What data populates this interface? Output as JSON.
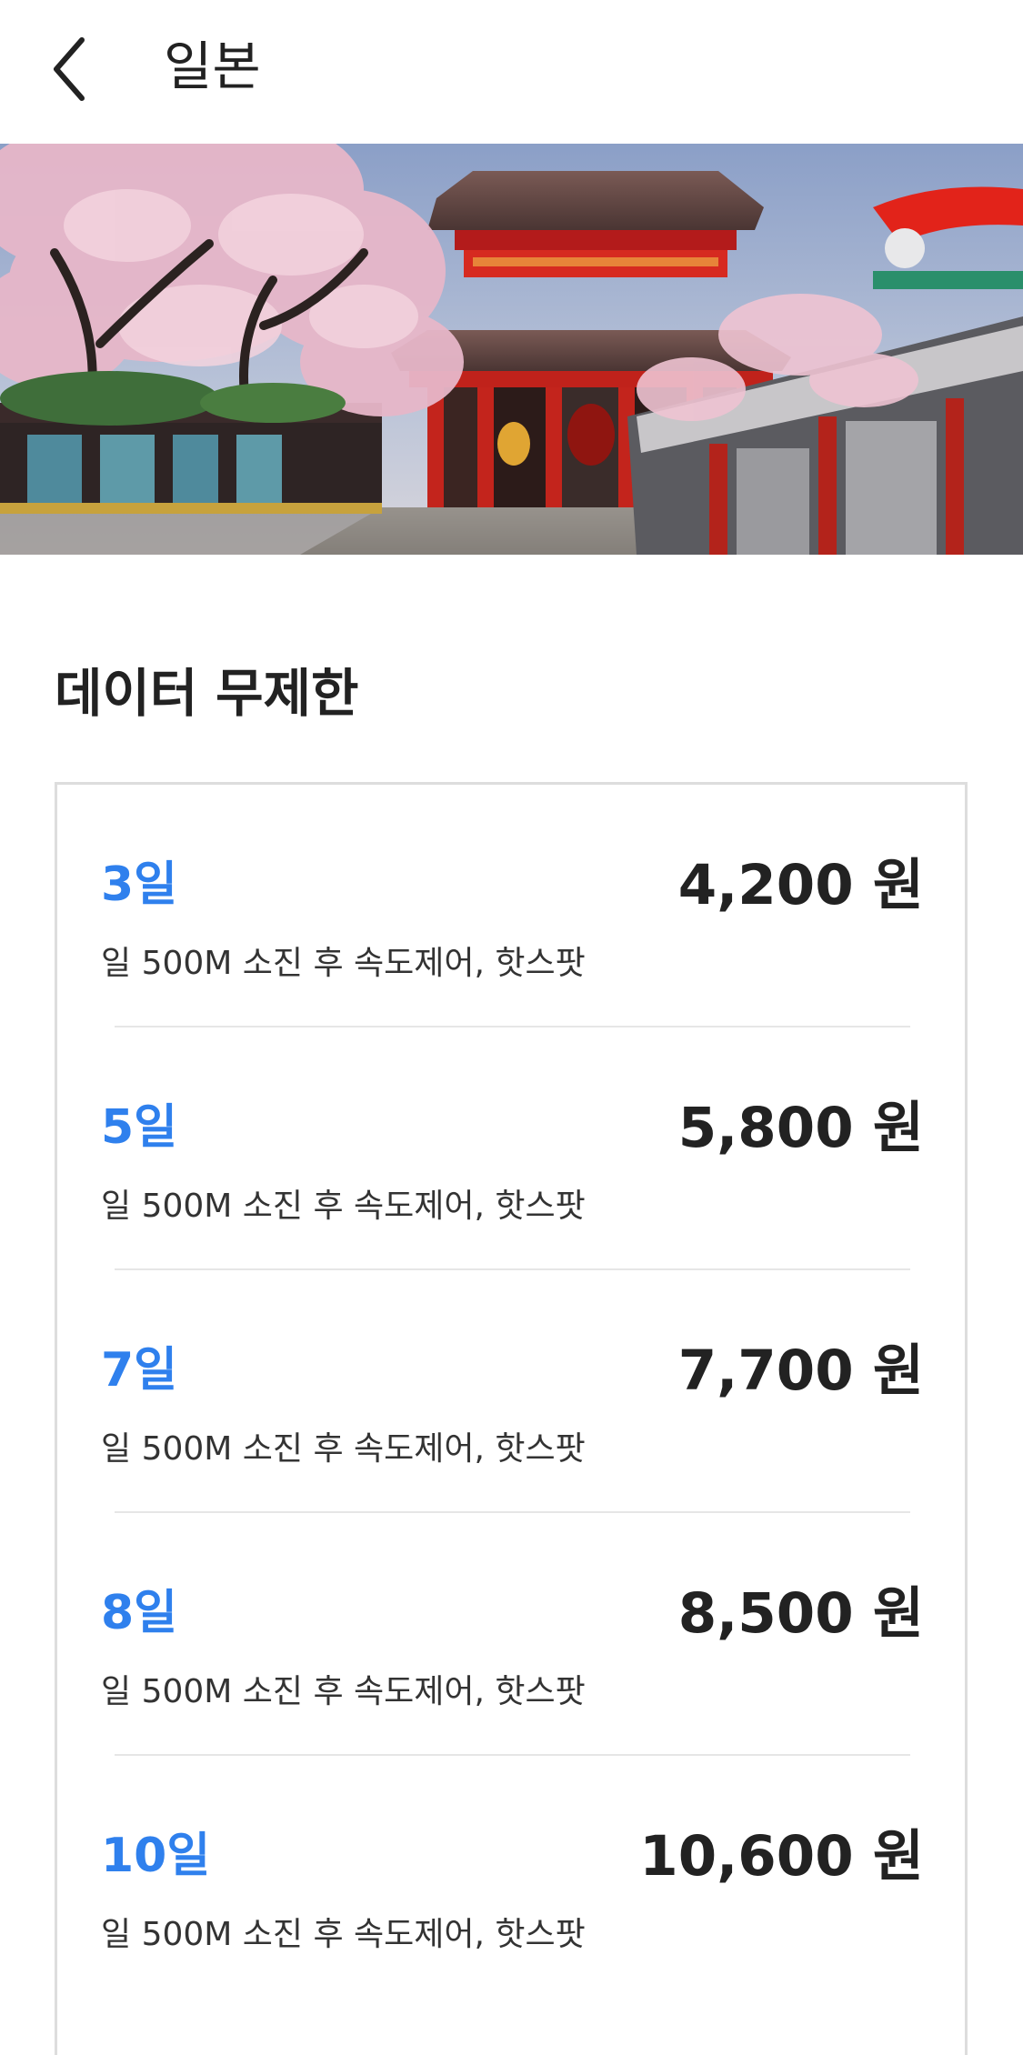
{
  "header": {
    "title": "일본",
    "back_icon": "chevron-left-icon"
  },
  "hero": {
    "alt": "일본"
  },
  "section": {
    "title": "데이터 무제한"
  },
  "plans": [
    {
      "days": "3일",
      "price": "4,200 원",
      "description": "일 500M 소진 후 속도제어, 핫스팟"
    },
    {
      "days": "5일",
      "price": "5,800 원",
      "description": "일 500M 소진 후 속도제어, 핫스팟"
    },
    {
      "days": "7일",
      "price": "7,700 원",
      "description": "일 500M 소진 후 속도제어, 핫스팟"
    },
    {
      "days": "8일",
      "price": "8,500 원",
      "description": "일 500M 소진 후 속도제어, 핫스팟"
    },
    {
      "days": "10일",
      "price": "10,600 원",
      "description": "일 500M 소진 후 속도제어, 핫스팟"
    }
  ],
  "colors": {
    "accent": "#2f80ed",
    "text": "#222222",
    "border": "#dddddd"
  }
}
